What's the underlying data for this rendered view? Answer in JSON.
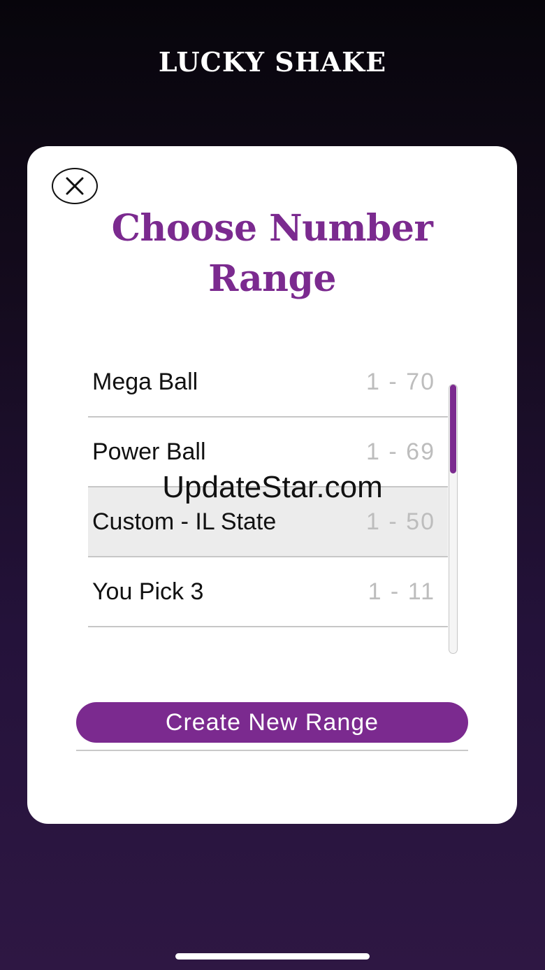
{
  "app": {
    "title": "LUCKY SHAKE"
  },
  "modal": {
    "close_icon": "close-icon",
    "title_line1": "Choose Number",
    "title_line2": "Range",
    "ranges": [
      {
        "name": "Mega Ball",
        "values": "1 - 70",
        "selected": false
      },
      {
        "name": "Power Ball",
        "values": "1 - 69",
        "selected": false
      },
      {
        "name": "Custom - IL State",
        "values": "1 - 50",
        "selected": true
      },
      {
        "name": "You Pick 3",
        "values": "1 - 11",
        "selected": false
      }
    ],
    "scroll_position": 0,
    "create_button_label": "Create New Range"
  },
  "watermark": "UpdateStar.com",
  "colors": {
    "accent": "#7b2a8f",
    "background_top": "#07050b",
    "background_bottom": "#2e1743",
    "selected_row": "#ececec",
    "range_value_text": "#bdbdbd"
  }
}
